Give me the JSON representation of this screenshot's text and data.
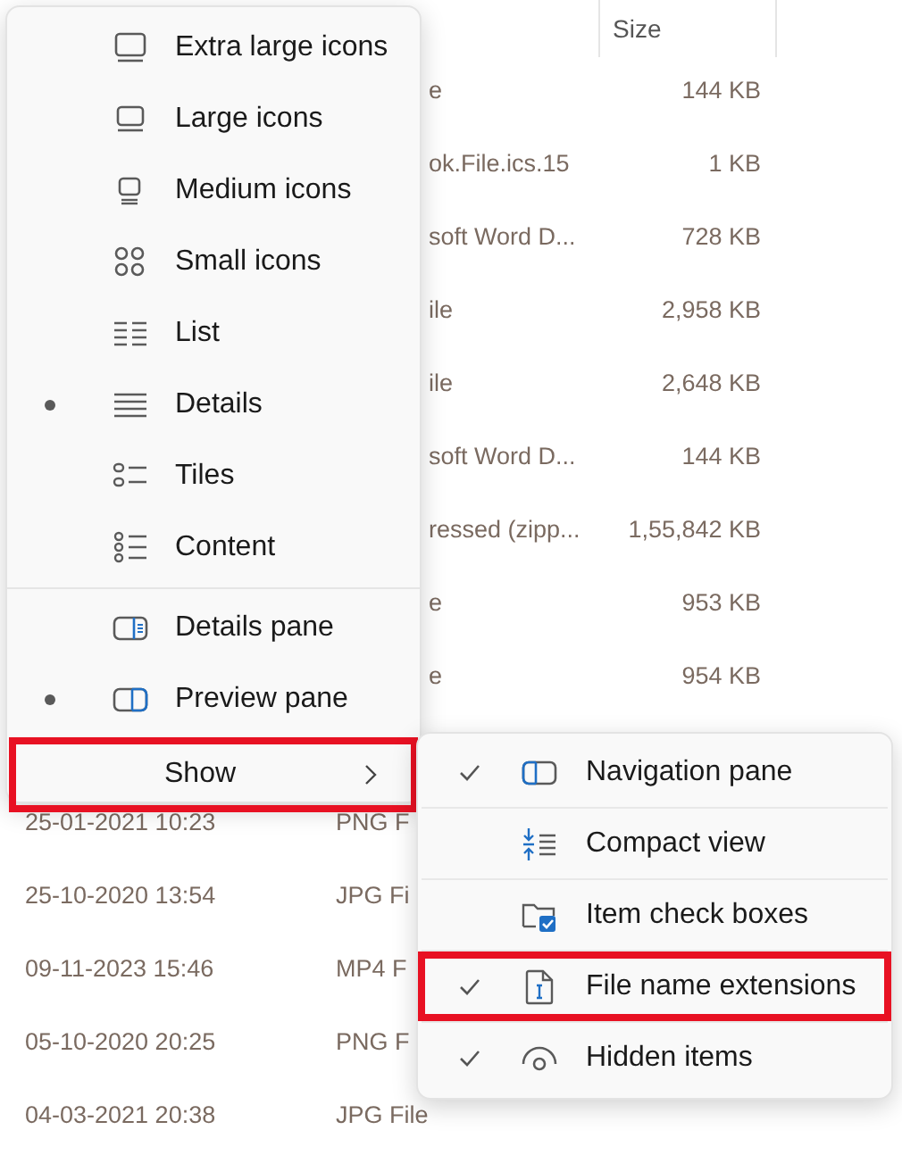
{
  "file_list": {
    "columns": [
      {
        "label": "Size"
      }
    ],
    "rows": [
      {
        "type": "e",
        "size": "144 KB"
      },
      {
        "type": "ok.File.ics.15",
        "size": "1 KB"
      },
      {
        "type": "soft Word D...",
        "size": "728 KB"
      },
      {
        "type": "ile",
        "size": "2,958 KB"
      },
      {
        "type": "ile",
        "size": "2,648 KB"
      },
      {
        "type": "soft Word D...",
        "size": "144 KB"
      },
      {
        "type": "ressed (zipp...",
        "size": "1,55,842 KB"
      },
      {
        "type": "e",
        "size": "953 KB"
      },
      {
        "type": "e",
        "size": "954 KB"
      },
      {
        "type": "",
        "size": ""
      },
      {
        "date": "25-01-2021 10:23",
        "type": "PNG F"
      },
      {
        "date": "25-10-2020 13:54",
        "type": "JPG Fi"
      },
      {
        "date": "09-11-2023 15:46",
        "type": "MP4 F"
      },
      {
        "date": "05-10-2020 20:25",
        "type": "PNG F"
      },
      {
        "date": "04-03-2021 20:38",
        "type": "JPG File"
      }
    ]
  },
  "view_menu": {
    "items": [
      {
        "label": "Extra large icons",
        "selected": false
      },
      {
        "label": "Large icons",
        "selected": false
      },
      {
        "label": "Medium icons",
        "selected": false
      },
      {
        "label": "Small icons",
        "selected": false
      },
      {
        "label": "List",
        "selected": false
      },
      {
        "label": "Details",
        "selected": true
      },
      {
        "label": "Tiles",
        "selected": false
      },
      {
        "label": "Content",
        "selected": false
      }
    ],
    "panes": [
      {
        "label": "Details pane",
        "selected": false
      },
      {
        "label": "Preview pane",
        "selected": true
      }
    ],
    "show": {
      "label": "Show",
      "highlighted": true
    }
  },
  "show_submenu": {
    "items": [
      {
        "label": "Navigation pane",
        "checked": true,
        "highlighted": false
      },
      {
        "label": "Compact view",
        "checked": false,
        "highlighted": false
      },
      {
        "label": "Item check boxes",
        "checked": false,
        "highlighted": false
      },
      {
        "label": "File name extensions",
        "checked": true,
        "highlighted": true
      },
      {
        "label": "Hidden items",
        "checked": true,
        "highlighted": false
      }
    ]
  }
}
